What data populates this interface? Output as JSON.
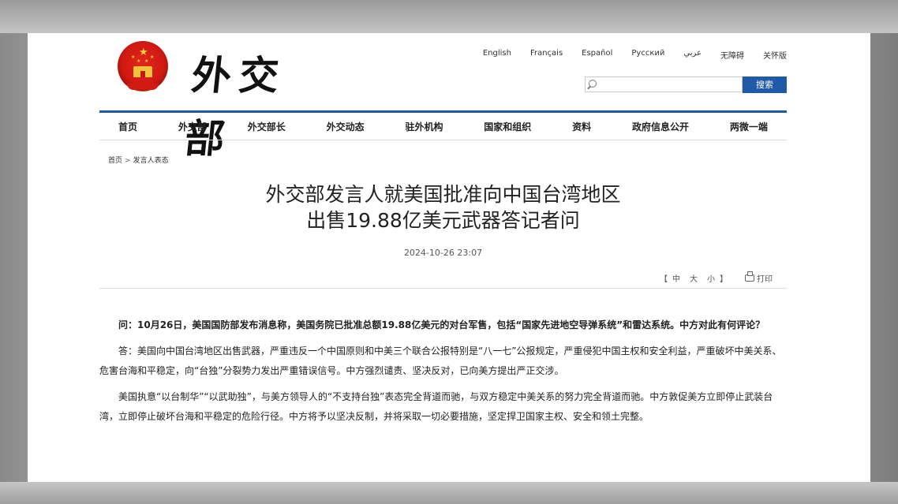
{
  "site": {
    "name": "外交部",
    "languages": [
      "English",
      "Français",
      "Español",
      "Русский",
      "عربي",
      "无障碍",
      "关怀版"
    ]
  },
  "search": {
    "placeholder": "",
    "button_label": "搜索"
  },
  "nav": {
    "items": [
      "首页",
      "外交部",
      "外交部长",
      "外交动态",
      "驻外机构",
      "国家和组织",
      "资料",
      "政府信息公开",
      "两微一端"
    ]
  },
  "breadcrumb": {
    "home": "首页",
    "separator": ">",
    "current": "发言人表态"
  },
  "article": {
    "title_line1": "外交部发言人就美国批准向中国台湾地区",
    "title_line2": "出售19.88亿美元武器答记者问",
    "date": "2024-10-26 23:07",
    "font_size": {
      "open": "【",
      "large": "中",
      "medium": "大",
      "small": "小",
      "close": "】"
    },
    "print_label": "打印",
    "paragraphs": [
      "问：10月26日，美国国防部发布消息称，美国务院已批准总额19.88亿美元的对台军售，包括“国家先进地空导弹系统”和雷达系统。中方对此有何评论？",
      "答：美国向中国台湾地区出售武器，严重违反一个中国原则和中美三个联合公报特别是“八一七”公报规定，严重侵犯中国主权和安全利益，严重破坏中美关系、危害台海和平稳定，向“台独”分裂势力发出严重错误信号。中方强烈谴责、坚决反对，已向美方提出严正交涉。",
      "美国执意“以台制华”“以武助独”，与美方领导人的“不支持台独”表态完全背道而驰，与双方稳定中美关系的努力完全背道而驰。中方敦促美方立即停止武装台湾，立即停止破坏台海和平稳定的危险行径。中方将予以坚决反制，并将采取一切必要措施，坚定捍卫国家主权、安全和领土完整。"
    ]
  },
  "colors": {
    "accent": "#1f5aa8",
    "emblem_red": "#d11a12",
    "emblem_gold": "#f0c23a"
  }
}
